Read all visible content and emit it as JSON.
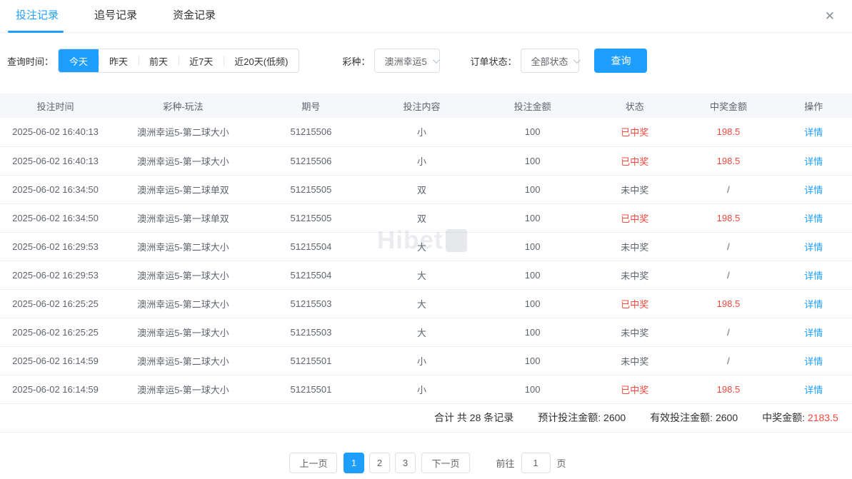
{
  "window": {
    "close_icon": "✕"
  },
  "tabs": [
    {
      "label": "投注记录",
      "state": "active"
    },
    {
      "label": "追号记录",
      "state": ""
    },
    {
      "label": "资金记录",
      "state": ""
    }
  ],
  "filters": {
    "time_label": "查询时间：",
    "time_options": [
      {
        "label": "今天",
        "state": "active"
      },
      {
        "label": "昨天",
        "state": ""
      },
      {
        "label": "前天",
        "state": ""
      },
      {
        "label": "近7天",
        "state": ""
      },
      {
        "label": "近20天(低频)",
        "state": ""
      }
    ],
    "lottery_label": "彩种：",
    "lottery_value": "澳洲幸运5",
    "status_label": "订单状态：",
    "status_value": "全部状态",
    "query_label": "查询"
  },
  "table": {
    "headers": [
      "投注时间",
      "彩种-玩法",
      "期号",
      "投注内容",
      "投注金额",
      "状态",
      "中奖金额",
      "操作"
    ],
    "rows": [
      {
        "time": "2025-06-02 16:40:13",
        "play": "澳洲幸运5-第二球大小",
        "issue": "51215506",
        "content": "小",
        "amount": "100",
        "status": "已中奖",
        "status_class": "win",
        "win_amount": "198.5",
        "win_class": "win",
        "action": "详情"
      },
      {
        "time": "2025-06-02 16:40:13",
        "play": "澳洲幸运5-第一球大小",
        "issue": "51215506",
        "content": "小",
        "amount": "100",
        "status": "已中奖",
        "status_class": "win",
        "win_amount": "198.5",
        "win_class": "win",
        "action": "详情"
      },
      {
        "time": "2025-06-02 16:34:50",
        "play": "澳洲幸运5-第二球单双",
        "issue": "51215505",
        "content": "双",
        "amount": "100",
        "status": "未中奖",
        "status_class": "",
        "win_amount": "/",
        "win_class": "",
        "action": "详情"
      },
      {
        "time": "2025-06-02 16:34:50",
        "play": "澳洲幸运5-第一球单双",
        "issue": "51215505",
        "content": "双",
        "amount": "100",
        "status": "已中奖",
        "status_class": "win",
        "win_amount": "198.5",
        "win_class": "win",
        "action": "详情"
      },
      {
        "time": "2025-06-02 16:29:53",
        "play": "澳洲幸运5-第二球大小",
        "issue": "51215504",
        "content": "大",
        "amount": "100",
        "status": "未中奖",
        "status_class": "",
        "win_amount": "/",
        "win_class": "",
        "action": "详情"
      },
      {
        "time": "2025-06-02 16:29:53",
        "play": "澳洲幸运5-第一球大小",
        "issue": "51215504",
        "content": "大",
        "amount": "100",
        "status": "未中奖",
        "status_class": "",
        "win_amount": "/",
        "win_class": "",
        "action": "详情"
      },
      {
        "time": "2025-06-02 16:25:25",
        "play": "澳洲幸运5-第二球大小",
        "issue": "51215503",
        "content": "大",
        "amount": "100",
        "status": "已中奖",
        "status_class": "win",
        "win_amount": "198.5",
        "win_class": "win",
        "action": "详情"
      },
      {
        "time": "2025-06-02 16:25:25",
        "play": "澳洲幸运5-第一球大小",
        "issue": "51215503",
        "content": "大",
        "amount": "100",
        "status": "未中奖",
        "status_class": "",
        "win_amount": "/",
        "win_class": "",
        "action": "详情"
      },
      {
        "time": "2025-06-02 16:14:59",
        "play": "澳洲幸运5-第二球大小",
        "issue": "51215501",
        "content": "小",
        "amount": "100",
        "status": "未中奖",
        "status_class": "",
        "win_amount": "/",
        "win_class": "",
        "action": "详情"
      },
      {
        "time": "2025-06-02 16:14:59",
        "play": "澳洲幸运5-第一球大小",
        "issue": "51215501",
        "content": "小",
        "amount": "100",
        "status": "已中奖",
        "status_class": "win",
        "win_amount": "198.5",
        "win_class": "win",
        "action": "详情"
      }
    ]
  },
  "watermark": "Hibet",
  "summary": {
    "total": "合计 共 28 条记录",
    "expected_label": "预计投注金额:",
    "expected_value": "2600",
    "valid_label": "有效投注金额:",
    "valid_value": "2600",
    "win_label": "中奖金额:",
    "win_value": "2183.5"
  },
  "pagination": {
    "prev": "上一页",
    "pages": [
      {
        "label": "1",
        "state": "active"
      },
      {
        "label": "2",
        "state": ""
      },
      {
        "label": "3",
        "state": ""
      }
    ],
    "next": "下一页",
    "goto_label": "前往",
    "goto_value": "1",
    "goto_unit": "页"
  },
  "colors": {
    "accent": "#1e9fff",
    "danger": "#f5483d",
    "header_bg": "#f5f7fa",
    "border": "#dcdfe6"
  }
}
